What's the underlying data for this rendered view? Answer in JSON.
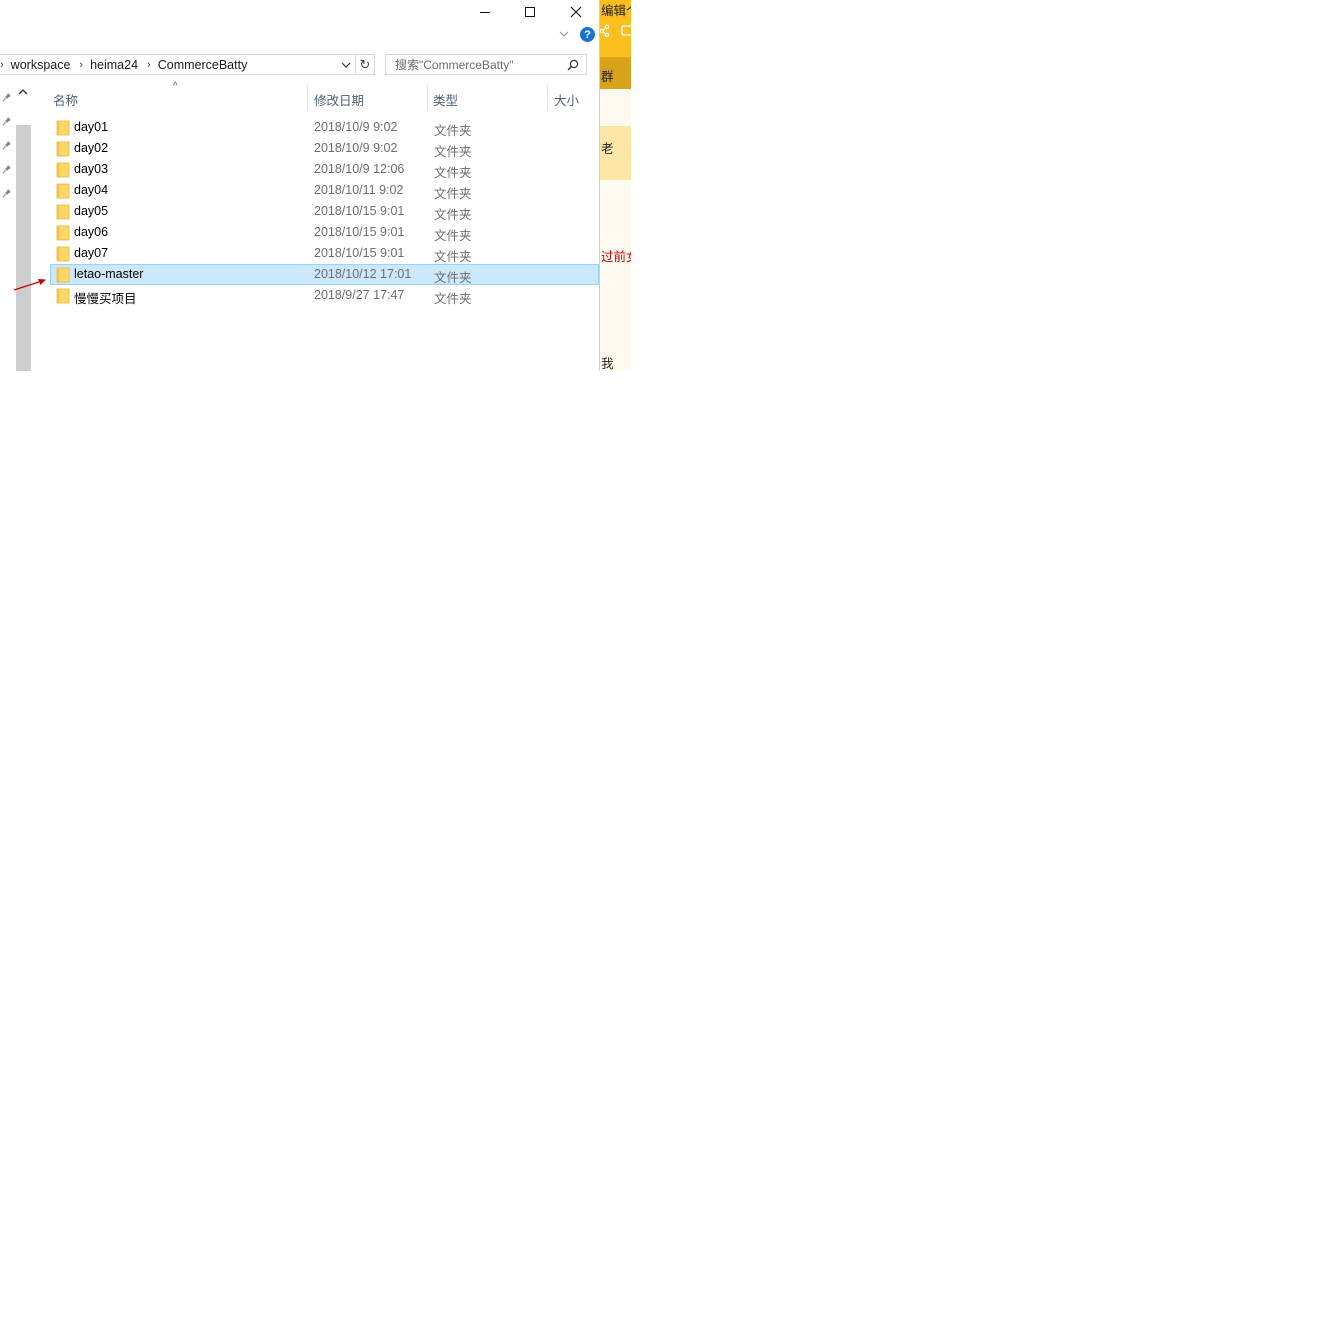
{
  "breadcrumb": {
    "items": [
      "workspace",
      "heima24",
      "CommerceBatty"
    ]
  },
  "search": {
    "placeholder": "搜索\"CommerceBatty\""
  },
  "columns": {
    "name": "名称",
    "date": "修改日期",
    "type": "类型",
    "size": "大小"
  },
  "files": [
    {
      "name": "day01",
      "date": "2018/10/9 9:02",
      "type": "文件夹"
    },
    {
      "name": "day02",
      "date": "2018/10/9 9:02",
      "type": "文件夹"
    },
    {
      "name": "day03",
      "date": "2018/10/9 12:06",
      "type": "文件夹"
    },
    {
      "name": "day04",
      "date": "2018/10/11 9:02",
      "type": "文件夹"
    },
    {
      "name": "day05",
      "date": "2018/10/15 9:01",
      "type": "文件夹"
    },
    {
      "name": "day06",
      "date": "2018/10/15 9:01",
      "type": "文件夹"
    },
    {
      "name": "day07",
      "date": "2018/10/15 9:01",
      "type": "文件夹"
    },
    {
      "name": "letao-master",
      "date": "2018/10/12 17:01",
      "type": "文件夹"
    },
    {
      "name": "慢慢买项目",
      "date": "2018/9/27 17:47",
      "type": "文件夹"
    }
  ],
  "selected_index": 7,
  "background_window": {
    "fragments": [
      "编辑个",
      "群",
      "老",
      "过前女",
      "我"
    ]
  },
  "colors": {
    "selection": "#cce8ff",
    "selection_border": "#99d1ff",
    "folder": "#ffd766",
    "header_text": "#4c607a",
    "annotation_arrow": "#cc0000",
    "bg_window_accent": "#fcbf1e",
    "bg_red_text": "#cc0000"
  }
}
